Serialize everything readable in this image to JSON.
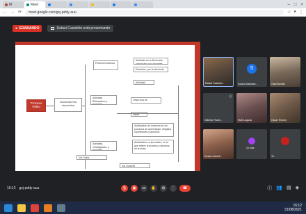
{
  "browser": {
    "tabs": [
      {
        "label": "M",
        "color": "#c0392b"
      },
      {
        "label": "Meet",
        "color": "#00897b"
      },
      {
        "label": "",
        "color": "#1a73e8"
      },
      {
        "label": "",
        "color": "#4285f4"
      },
      {
        "label": "",
        "color": "#fbbc04"
      },
      {
        "label": "",
        "color": "#1a73e8"
      },
      {
        "label": "",
        "color": "#4285f4"
      }
    ],
    "url": "meet.google.com/gsj-pddy-auu",
    "window_controls": [
      "–",
      "□",
      "×"
    ]
  },
  "meeting": {
    "recording_label": "GRABANDO",
    "presenter_text": "Rafael Castellón está presentando",
    "code": "gsj-pddy-auu",
    "time": "16:12"
  },
  "slide": {
    "root_label": "Proceso Vídeo",
    "center_label": "Docencia Vía sincrónica",
    "nodes": [
      "Primera Docencia",
      "Actividad en la Docencia, organizada por docentes",
      "Docentes, por la docencia de docentes",
      "Actividad Retroactiva, y docentes, investigación",
      "Otras vías de construcción, Participación",
      "Actividad",
      "Datos",
      "Actividad, investigación, y docentes",
      "Actividades de docencia en los procesos de aprendizaje, dirigidos a profesores y alumnos",
      "Actividades en las clases, en lo que refiere al proceso y alumnos en la clase",
      "Vía Datos",
      "Vía Docente"
    ]
  },
  "participants": [
    {
      "name": "Rafael Castellón",
      "type": "camera"
    },
    {
      "name": "Solana Salvador...",
      "type": "avatar",
      "initial": "S",
      "color": "#1a73e8"
    },
    {
      "name": "Gisel Bonilla",
      "type": "camera"
    },
    {
      "name": "Gilberto Pache...",
      "type": "muted"
    },
    {
      "name": "Ruth Laguna",
      "type": "camera"
    },
    {
      "name": "Oscar Tercero",
      "type": "camera"
    },
    {
      "name": "Cesar Umberti...",
      "type": "camera"
    },
    {
      "name": "24 más",
      "type": "more"
    },
    {
      "name": "Tú",
      "type": "self"
    }
  ],
  "controls": [
    "mic-off",
    "cam-off",
    "captions",
    "raise-hand",
    "present",
    "more",
    "end-call"
  ],
  "taskbar": {
    "time": "16:12",
    "date": "31/08/2021"
  },
  "colors": {
    "accent": "#c0392b",
    "meet_bg": "#202124",
    "tile_bg": "#3c4043",
    "danger": "#ea4335"
  }
}
